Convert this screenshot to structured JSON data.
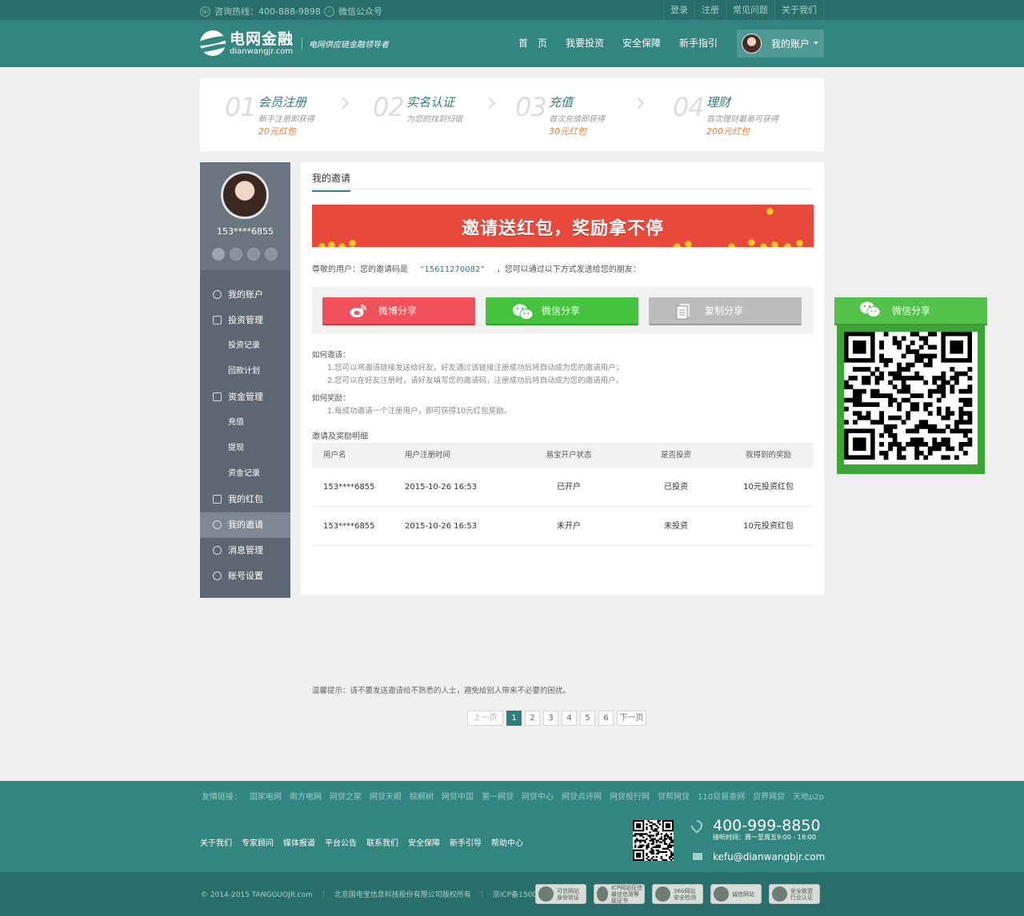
{
  "topbar": {
    "hotline": "咨询热线：400-888-9898",
    "wechat": "微信公众号",
    "links": [
      "登录",
      "注册",
      "常见问题",
      "关于我们"
    ]
  },
  "header": {
    "logo_cn": "电网金融",
    "logo_en": "dianwangjr.com",
    "slogan": "电网供应链金融领导者",
    "nav": [
      "首　页",
      "我要投资",
      "安全保障",
      "新手指引"
    ],
    "account": "我的账户"
  },
  "steps": [
    {
      "num": "01",
      "title": "会员注册",
      "desc": "新手注册即获得",
      "reward": "20元红包"
    },
    {
      "num": "02",
      "title": "实名认证",
      "desc": "为您的找到归宿",
      "reward": ""
    },
    {
      "num": "03",
      "title": "充值",
      "desc": "首次充值即获得",
      "reward": "30元红包"
    },
    {
      "num": "04",
      "title": "理财",
      "desc": "首次理财最高可获得",
      "reward": "200元红包"
    }
  ],
  "sidebar": {
    "phone": "153****6855",
    "menu": [
      {
        "label": "我的账户",
        "type": "main",
        "icon": "user-icon"
      },
      {
        "label": "投资管理",
        "type": "main",
        "icon": "document-icon"
      },
      {
        "label": "投资记录",
        "type": "sub"
      },
      {
        "label": "回款计划",
        "type": "sub"
      },
      {
        "label": "资金管理",
        "type": "main",
        "icon": "money-icon"
      },
      {
        "label": "充值",
        "type": "sub"
      },
      {
        "label": "提现",
        "type": "sub"
      },
      {
        "label": "资金记录",
        "type": "sub"
      },
      {
        "label": "我的红包",
        "type": "main",
        "icon": "redpacket-icon"
      },
      {
        "label": "我的邀请",
        "type": "main",
        "icon": "invite-icon",
        "active": true
      },
      {
        "label": "消息管理",
        "type": "main",
        "icon": "message-icon"
      },
      {
        "label": "账号设置",
        "type": "main",
        "icon": "gear-icon"
      }
    ]
  },
  "main": {
    "tab_title": "我的邀请",
    "banner_text": "邀请送红包，奖励拿不停",
    "intro_prefix": "尊敬的用户：您的邀请码是",
    "invite_code": "“15611270082”",
    "intro_suffix": "，您可以通过以下方式发送给您的朋友：",
    "share": {
      "weibo": "微博分享",
      "wechat": "微信分享",
      "copy": "复制分享"
    },
    "howto_title": "如何邀请：",
    "howto_1": "1.您可以将邀请链接发送给好友，好友通过该链接注册成功后将自动成为您的邀请用户；",
    "howto_2": "2.您可以在好友注册时，请好友填写您的邀请码，注册成功后将自动成为您的邀请用户。",
    "reward_title": "如何奖励：",
    "reward_1": "1.每成功邀请一个注册用户，即可获得10元红包奖励。",
    "table_title": "邀请及奖励明细",
    "table_headers": [
      "用户名",
      "用户注册时间",
      "易宝开户状态",
      "是否投资",
      "我得到的奖励"
    ],
    "table_rows": [
      [
        "153****6855",
        "2015-10-26 16:53",
        "已开户",
        "已投资",
        "10元投资红包"
      ],
      [
        "153****6855",
        "2015-10-26 16:53",
        "未开户",
        "未投资",
        "10元投资红包"
      ]
    ],
    "tip": "温馨提示：请不要发送邀请给不熟悉的人士，避免给别人带来不必要的困扰。",
    "pager": {
      "prev": "上一页",
      "pages": [
        "1",
        "2",
        "3",
        "4",
        "5",
        "6"
      ],
      "current": "1",
      "next": "下一页"
    }
  },
  "float_share": {
    "label": "微信分享"
  },
  "footer": {
    "friend_links": [
      "友情链接：",
      "国家电网",
      "南方电网",
      "网贷之家",
      "网贷天眼",
      "棕榈树",
      "网贷中国",
      "第一网贷",
      "网贷中心",
      "网贷点评网",
      "网贷投行网",
      "贷帮网贷",
      "110贷易查网",
      "贷界网贷",
      "天地p2p"
    ],
    "links": [
      "关于我们",
      "专家顾问",
      "媒体报道",
      "平台公告",
      "联系我们",
      "安全保障",
      "新手引导",
      "帮助中心"
    ],
    "phone": "400-999-8850",
    "hours": "接听时间：周一至周五9:00 - 18:00",
    "email": "kefu@dianwangbjr.com",
    "copyright": "© 2014-2015 TANGGUOJR.com　｜　北京国电宝信息科技股份有限公司版权所有　｜　京ICP备15004776号",
    "certs": [
      {
        "l1": "可信网站",
        "l2": "身份验证"
      },
      {
        "l1": "ICP网站征信",
        "l2": "最佳信用等级证书"
      },
      {
        "l1": "360网站",
        "l2": "安全检测"
      },
      {
        "l1": "诚信网站",
        "l2": ""
      },
      {
        "l1": "安全联盟",
        "l2": "行业认证"
      }
    ]
  },
  "colors": {
    "primary": "#338580",
    "topbar": "#286e6a",
    "accent_orange": "#ef7c36",
    "weibo": "#f0515a",
    "wechat": "#45c33f",
    "sidebar": "#5d6772"
  }
}
